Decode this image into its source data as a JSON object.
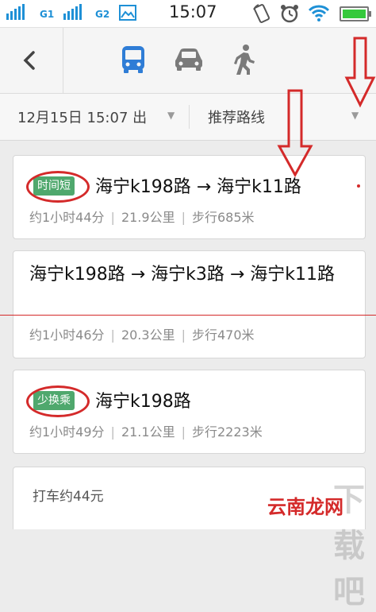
{
  "status_bar": {
    "sim1_label": "G1",
    "sim2_label": "G2",
    "time": "15:07",
    "battery_level": 1.0
  },
  "nav": {
    "modes": [
      {
        "name": "bus",
        "icon": "bus-icon",
        "active": true
      },
      {
        "name": "car",
        "icon": "car-icon",
        "active": false
      },
      {
        "name": "walk",
        "icon": "walk-icon",
        "active": false
      }
    ],
    "active_color": "#2f7dd6",
    "inactive_color": "#7a7a7a"
  },
  "filter": {
    "departure": "12月15日 15:07 出",
    "sort": "推荐路线"
  },
  "routes": [
    {
      "badge": "时间短",
      "name": "海宁k198路 → 海宁k11路",
      "duration": "约1小时44分",
      "distance": "21.9公里",
      "walk": "步行685米"
    },
    {
      "badge": "",
      "name": "海宁k198路 → 海宁k3路 → 海宁k11路",
      "duration": "约1小时46分",
      "distance": "20.3公里",
      "walk": "步行470米"
    },
    {
      "badge": "少换乘",
      "name": "海宁k198路",
      "duration": "约1小时49分",
      "distance": "21.1公里",
      "walk": "步行2223米"
    }
  ],
  "taxi": {
    "label": "打车约44元"
  },
  "watermark": {
    "text": "云南龙网",
    "bg_text": "下载吧"
  },
  "colors": {
    "badge_green": "#4fa86d",
    "annotation_red": "#d42a2a"
  }
}
